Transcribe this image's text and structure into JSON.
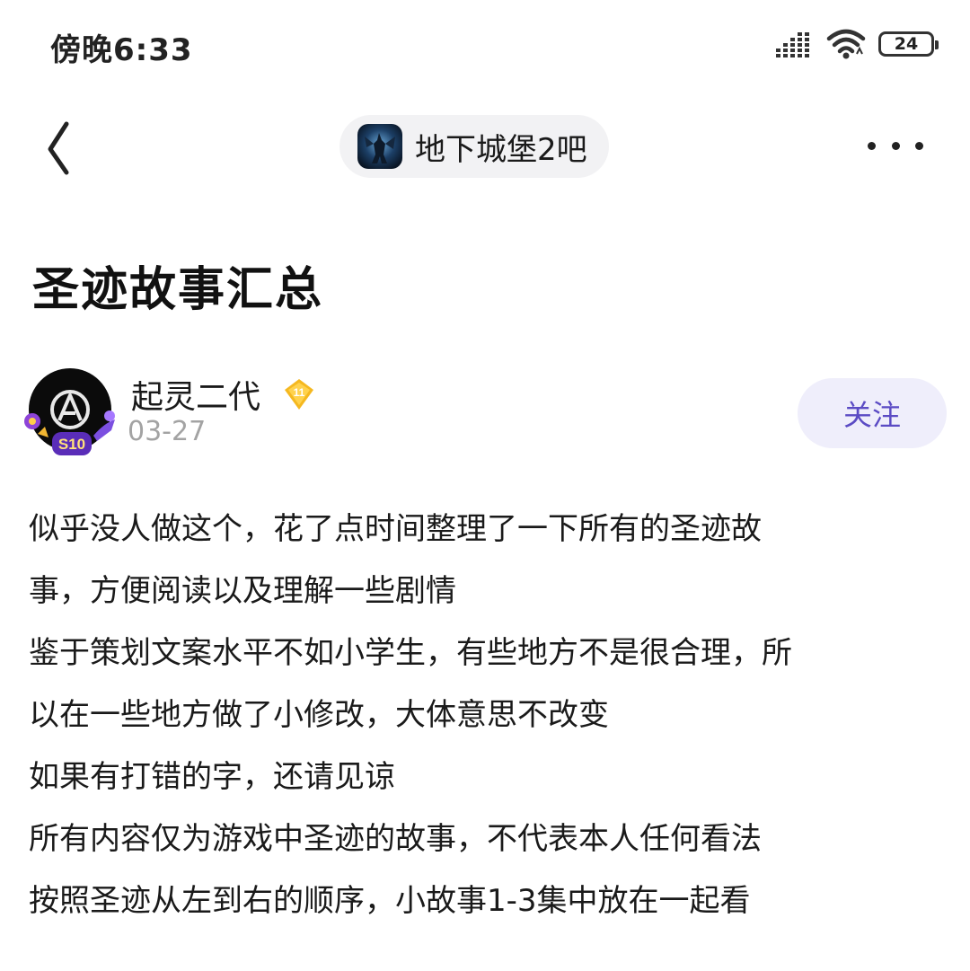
{
  "status_bar": {
    "time": "傍晚6:33",
    "battery": "24"
  },
  "nav": {
    "forum_name": "地下城堡2吧"
  },
  "post": {
    "title": "圣迹故事汇总",
    "author": {
      "name": "起灵二代",
      "level": "11",
      "date": "03-27",
      "medal": "S10"
    },
    "follow_label": "关注",
    "body": [
      "似乎没人做这个，花了点时间整理了一下所有的圣迹故",
      "事，方便阅读以及理解一些剧情",
      "鉴于策划文案水平不如小学生，有些地方不是很合理，所",
      "以在一些地方做了小修改，大体意思不改变",
      "如果有打错的字，还请见谅",
      "所有内容仅为游戏中圣迹的故事，不代表本人任何看法",
      "按照圣迹从左到右的顺序，小故事1-3集中放在一起看"
    ]
  },
  "icons": {
    "back": "chevron-left-icon",
    "more": "more-horizontal-icon",
    "signal": "signal-icon",
    "wifi": "wifi-icon",
    "battery": "battery-icon",
    "level": "level-diamond-icon"
  },
  "colors": {
    "accent": "#5b4bc4",
    "follow_bg": "#efeefb",
    "level_badge": "#f5b81f",
    "pill_bg": "#f2f2f4"
  }
}
